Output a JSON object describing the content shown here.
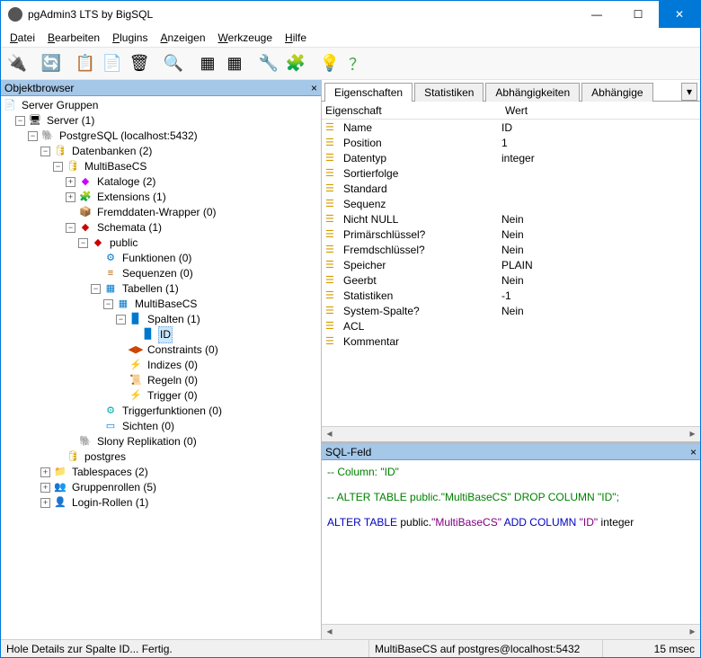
{
  "window": {
    "title": "pgAdmin3 LTS by BigSQL"
  },
  "menu": {
    "datei": "Datei",
    "bearbeiten": "Bearbeiten",
    "plugins": "Plugins",
    "anzeigen": "Anzeigen",
    "werkzeuge": "Werkzeuge",
    "hilfe": "Hilfe"
  },
  "panes": {
    "browser": "Objektbrowser",
    "sql": "SQL-Feld"
  },
  "tabs": {
    "eigenschaften": "Eigenschaften",
    "statistiken": "Statistiken",
    "abhaengigkeiten": "Abhängigkeiten",
    "abhaengige": "Abhängige"
  },
  "proph": {
    "name": "Eigenschaft",
    "value": "Wert"
  },
  "props": [
    {
      "n": "Name",
      "v": "ID"
    },
    {
      "n": "Position",
      "v": "1"
    },
    {
      "n": "Datentyp",
      "v": "integer"
    },
    {
      "n": "Sortierfolge",
      "v": ""
    },
    {
      "n": "Standard",
      "v": ""
    },
    {
      "n": "Sequenz",
      "v": ""
    },
    {
      "n": "Nicht NULL",
      "v": "Nein"
    },
    {
      "n": "Primärschlüssel?",
      "v": "Nein"
    },
    {
      "n": "Fremdschlüssel?",
      "v": "Nein"
    },
    {
      "n": "Speicher",
      "v": "PLAIN"
    },
    {
      "n": "Geerbt",
      "v": "Nein"
    },
    {
      "n": "Statistiken",
      "v": "-1"
    },
    {
      "n": "System-Spalte?",
      "v": "Nein"
    },
    {
      "n": "ACL",
      "v": ""
    },
    {
      "n": "Kommentar",
      "v": ""
    }
  ],
  "tree": {
    "servergroups": "Server Gruppen",
    "server": "Server (1)",
    "pg": "PostgreSQL (localhost:5432)",
    "dbs": "Datenbanken (2)",
    "db1": "MultiBaseCS",
    "cat": "Kataloge  (2)",
    "ext": "Extensions  (1)",
    "fdw": "Fremddaten-Wrapper (0)",
    "schemas": "Schemata (1)",
    "public": "public",
    "funcs": "Funktionen (0)",
    "seqs": "Sequenzen (0)",
    "tables": "Tabellen (1)",
    "tbl": "MultiBaseCS",
    "cols": "Spalten (1)",
    "colid": "ID",
    "constraints": "Constraints (0)",
    "indices": "Indizes (0)",
    "rules": "Regeln (0)",
    "triggers": "Trigger (0)",
    "tfuncs": "Triggerfunktionen (0)",
    "views": "Sichten (0)",
    "slony": "Slony Replikation (0)",
    "db2": "postgres",
    "tblspaces": "Tablespaces (2)",
    "grproles": "Gruppenrollen (5)",
    "loginroles": "Login-Rollen (1)"
  },
  "sql": {
    "l1": "-- Column: \"ID\"",
    "l2": "-- ALTER TABLE public.\"MultiBaseCS\" DROP COLUMN \"ID\";",
    "l3a": "ALTER",
    "l3b": " TABLE",
    "l3c": " public.",
    "l3d": "\"MultiBaseCS\"",
    "l3e": " ADD COLUMN ",
    "l3f": "\"ID\"",
    "l3g": " integer"
  },
  "status": {
    "s1": "Hole Details zur Spalte ID... Fertig.",
    "s2": "MultiBaseCS auf postgres@localhost:5432",
    "s3": "15 msec"
  }
}
